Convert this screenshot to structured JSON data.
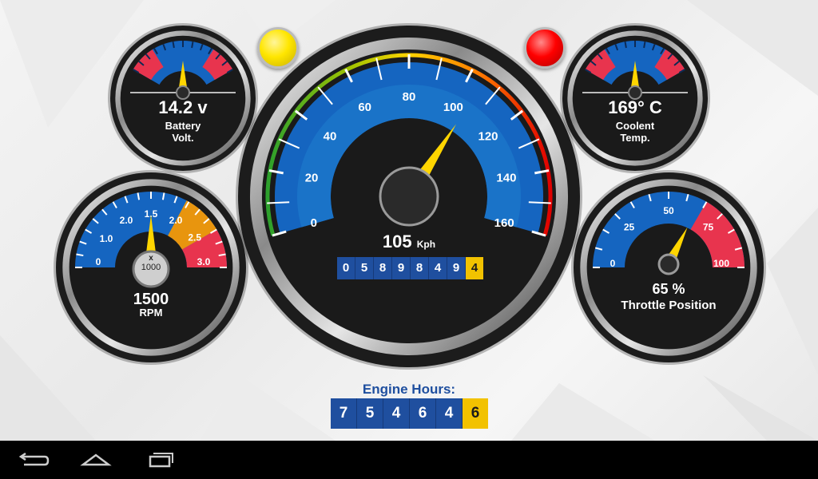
{
  "colors": {
    "dial_blue": "#1565c0",
    "dial_blue_light": "#2b8ad8",
    "needle": "#ffd500",
    "danger": "#e8344e",
    "warn_orange": "#e8950e",
    "odo_blue": "#1f4f9f",
    "odo_yellow": "#f2c200",
    "warning_light_yellow": "#ffe600",
    "warning_light_red": "#ff0000"
  },
  "battery": {
    "value": "14.2 v",
    "label_line1": "Battery",
    "label_line2": "Volt.",
    "needle_fraction": 0.5
  },
  "coolant": {
    "value": "169° C",
    "label_line1": "Coolent",
    "label_line2": "Temp.",
    "needle_fraction": 0.5
  },
  "speedometer": {
    "ticks": [
      "0",
      "20",
      "40",
      "60",
      "80",
      "100",
      "120",
      "140",
      "160"
    ],
    "min": 0,
    "max": 160,
    "speed": 105,
    "speed_value": "105",
    "speed_unit": "Kph",
    "odometer": [
      "0",
      "5",
      "8",
      "9",
      "8",
      "4",
      "9",
      "4"
    ]
  },
  "tachometer": {
    "ticks": [
      "0",
      "1.0",
      "2.0",
      "1.5",
      "2.0",
      "2.5",
      "3.0"
    ],
    "multiplier_line1": "x",
    "multiplier_line2": "1000",
    "value": "1500",
    "unit": "RPM",
    "needle_fraction": 0.5
  },
  "throttle": {
    "ticks": [
      "0",
      "25",
      "50",
      "75",
      "100"
    ],
    "value": "65 %",
    "label": "Throttle Position",
    "percent": 65
  },
  "engine_hours": {
    "title": "Engine Hours:",
    "digits": [
      "7",
      "5",
      "4",
      "6",
      "4",
      "6"
    ]
  },
  "navbar": {
    "icons": [
      "back-icon",
      "home-icon",
      "recent-apps-icon"
    ]
  }
}
